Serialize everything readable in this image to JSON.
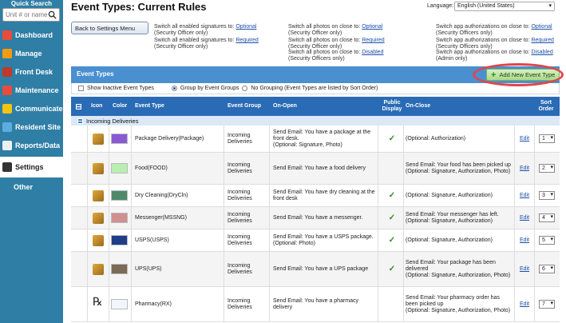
{
  "sidebar": {
    "quick_search_label": "Quick Search",
    "search_placeholder": "Unit # or name",
    "items": [
      {
        "label": "Dashboard",
        "icon": "dashboard-icon",
        "color": "#e74c3c"
      },
      {
        "label": "Manage",
        "icon": "manage-icon",
        "color": "#f39c12"
      },
      {
        "label": "Front Desk",
        "icon": "front-desk-icon",
        "color": "#c0392b"
      },
      {
        "label": "Maintenance",
        "icon": "maintenance-icon",
        "color": "#e74c3c"
      },
      {
        "label": "Communicate",
        "icon": "communicate-icon",
        "color": "#f1c40f"
      },
      {
        "label": "Resident Site",
        "icon": "resident-site-icon",
        "color": "#5dade2"
      },
      {
        "label": "Reports/Data",
        "icon": "reports-icon",
        "color": "#ecf0f1"
      },
      {
        "label": "Settings",
        "icon": "settings-icon",
        "color": "#333333"
      },
      {
        "label": "Other",
        "icon": "",
        "color": ""
      }
    ]
  },
  "header": {
    "title": "Event Types: Current Rules",
    "language_label": "Language:",
    "language_value": "English (United States)"
  },
  "back_button": "Back to Settings Menu",
  "toggles": [
    {
      "line1": "Switch all enabled signatures to:",
      "link": "Optional",
      "line2": "(Security Officer only)"
    },
    {
      "line1": "Switch all enabled signatures to:",
      "link": "Required",
      "line2": "(Security Officer only)"
    },
    {
      "line1": "Switch all photos on close to:",
      "link": "Optional",
      "line2": "(Security Officer only)"
    },
    {
      "line1": "Switch all photos on close to:",
      "link": "Required",
      "line2": "(Security Officer only)"
    },
    {
      "line1": "Switch all photos on close to:",
      "link": "Disabled",
      "line2": "(Security Officers only)"
    },
    {
      "line1": "Switch app authorizations on close to:",
      "link": "Optional",
      "line2": "(Security Officers only)"
    },
    {
      "line1": "Switch app authorizations on close to:",
      "link": "Required",
      "line2": "(Security Officers only)"
    },
    {
      "line1": "Switch app authorizations on close to:",
      "link": "Disabled",
      "line2": "(Admin only)"
    }
  ],
  "section": {
    "title": "Event Types",
    "add_button": "Add New Event Type",
    "show_inactive": "Show Inactive Event Types",
    "group_by": "Group by Event Groups",
    "no_grouping": "No Grouping (Event Types are listed by Sort Order)"
  },
  "columns": {
    "icon": "Icon",
    "color": "Color",
    "event_type": "Event Type",
    "event_group": "Event Group",
    "on_open": "On-Open",
    "public_display": "Public Display",
    "on_close": "On-Close",
    "sort_order": "Sort Order"
  },
  "group_name": "Incoming Deliveries",
  "edit_label": "Edit",
  "rows": [
    {
      "icon": "package-icon",
      "color": "#8a5ad4",
      "name": "Package Delivery(Package)",
      "group": "Incoming Deliveries",
      "on_open": "Send Email: You have a package at the front desk.\n(Optional: Signature, Photo)",
      "public": true,
      "on_close": "(Optional: Authorization)",
      "sort": "1"
    },
    {
      "icon": "food-icon",
      "color": "#b8efb0",
      "name": "Food(FOOD)",
      "group": "Incoming Deliveries",
      "on_open": "Send Email: You have a food delivery",
      "public": false,
      "on_close": "Send Email: Your food has been picked up\n(Optional: Signature, Authorization, Photo)",
      "sort": "2"
    },
    {
      "icon": "dry-cleaning-icon",
      "color": "#4e8a6a",
      "name": "Dry Cleaning(DryCln)",
      "group": "Incoming Deliveries",
      "on_open": "Send Email: You have dry cleaning at the front desk",
      "public": true,
      "on_close": "(Optional: Signature, Authorization)",
      "sort": "3"
    },
    {
      "icon": "messenger-icon",
      "color": "#d09090",
      "name": "Messenger(MSSNG)",
      "group": "Incoming Deliveries",
      "on_open": "Send Email: You have a messenger.",
      "public": true,
      "on_close": "Send Email: Your messenger has left.\n(Optional: Signature, Authorization)",
      "sort": "4"
    },
    {
      "icon": "usps-icon",
      "color": "#1e3f86",
      "name": "USPS(USPS)",
      "group": "Incoming Deliveries",
      "on_open": "Send Email: You have a USPS package.\n(Optional: Photo)",
      "public": true,
      "on_close": "(Optional: Signature, Authorization)",
      "sort": "5"
    },
    {
      "icon": "ups-icon",
      "color": "#7a6a56",
      "name": "UPS(UPS)",
      "group": "Incoming Deliveries",
      "on_open": "Send Email: You have a UPS package",
      "public": true,
      "on_close": "Send Email: Your package has been delivered\n(Optional: Signature, Authorization, Photo)",
      "sort": "6"
    },
    {
      "icon": "pharmacy-rx-icon",
      "color": "#f3f5fb",
      "name": "Pharmacy(RX)",
      "group": "Incoming Deliveries",
      "on_open": "Send Email: You have a pharmacy delivery",
      "public": false,
      "on_close": "Send Email: Your pharmacy order has been picked up\n(Optional: Signature, Authorization, Photo)",
      "sort": "7"
    }
  ]
}
